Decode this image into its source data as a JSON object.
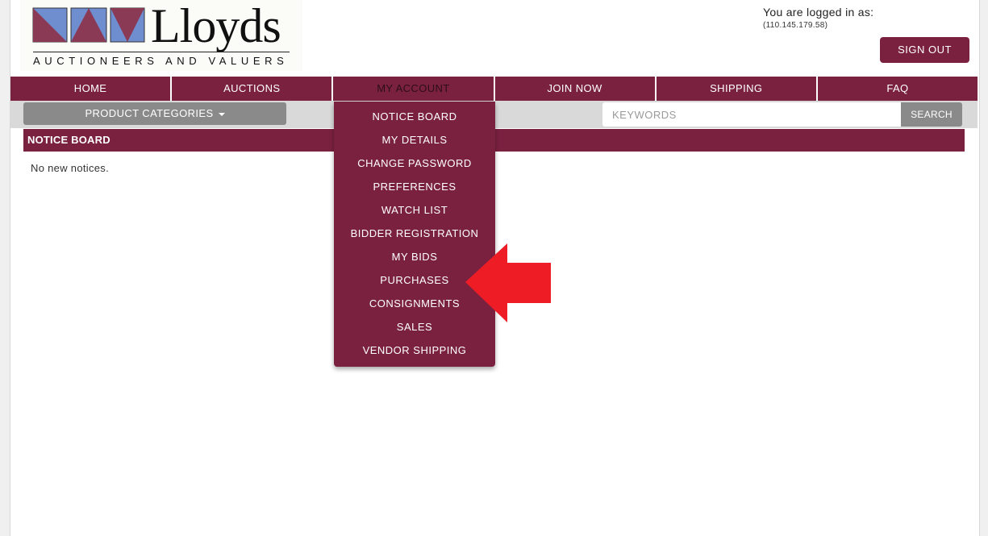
{
  "logo": {
    "name": "Lloyds",
    "tagline": "AUCTIONEERS AND VALUERS",
    "colors": {
      "blue": "#6f8ed0",
      "maroon": "#8a3a55"
    }
  },
  "account": {
    "logged_in_label": "You are logged in as:",
    "ip": "(110.145.179.58)",
    "sign_out_label": "SIGN OUT"
  },
  "nav": {
    "items": [
      {
        "label": "HOME"
      },
      {
        "label": "AUCTIONS"
      },
      {
        "label": "MY ACCOUNT"
      },
      {
        "label": "JOIN NOW"
      },
      {
        "label": "SHIPPING"
      },
      {
        "label": "FAQ"
      }
    ]
  },
  "subbar": {
    "categories_label": "PRODUCT CATEGORIES",
    "keywords_placeholder": "KEYWORDS",
    "search_label": "SEARCH"
  },
  "notice_board": {
    "title": "NOTICE BOARD",
    "message": "No new notices."
  },
  "dropdown": {
    "items": [
      {
        "label": "NOTICE BOARD"
      },
      {
        "label": "MY DETAILS"
      },
      {
        "label": "CHANGE PASSWORD"
      },
      {
        "label": "PREFERENCES"
      },
      {
        "label": "WATCH LIST"
      },
      {
        "label": "BIDDER REGISTRATION"
      },
      {
        "label": "MY BIDS"
      },
      {
        "label": "PURCHASES"
      },
      {
        "label": "CONSIGNMENTS"
      },
      {
        "label": "SALES"
      },
      {
        "label": "VENDOR SHIPPING"
      }
    ]
  },
  "colors": {
    "brand": "#7b2140",
    "grey_button": "#8a8a8a",
    "subbar_bg": "#d9d9d9",
    "annotation_arrow": "#ee1c25"
  }
}
